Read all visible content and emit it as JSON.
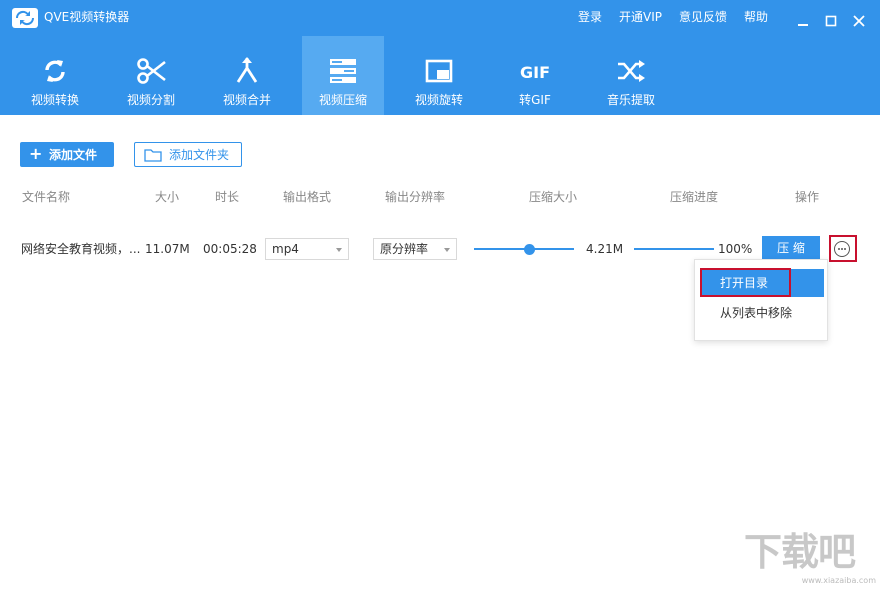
{
  "app": {
    "title": "QVE视频转换器"
  },
  "top_links": [
    "登录",
    "开通VIP",
    "意见反馈",
    "帮助"
  ],
  "toolbar": {
    "tools": [
      {
        "label": "视频转换",
        "icon": "convert-icon"
      },
      {
        "label": "视频分割",
        "icon": "scissors-icon"
      },
      {
        "label": "视频合并",
        "icon": "merge-icon"
      },
      {
        "label": "视频压缩",
        "icon": "compress-icon",
        "active": true
      },
      {
        "label": "视频旋转",
        "icon": "rotate-icon"
      },
      {
        "label": "转GIF",
        "icon": "gif-icon",
        "glyph": "GIF"
      },
      {
        "label": "音乐提取",
        "icon": "shuffle-icon"
      }
    ]
  },
  "actions": {
    "add_file": "添加文件",
    "add_folder": "添加文件夹"
  },
  "table": {
    "headers": [
      "文件名称",
      "大小",
      "时长",
      "输出格式",
      "输出分辨率",
      "压缩大小",
      "压缩进度",
      "操作"
    ],
    "rows": [
      {
        "name": "网络安全教育视频，...",
        "size": "11.07M",
        "duration": "00:05:28",
        "format": "mp4",
        "resolution": "原分辨率",
        "compressed_size": "4.21M",
        "compression_level": 0.6,
        "progress": "100%",
        "progress_value": 1.0,
        "action": "压 缩"
      }
    ]
  },
  "menu": {
    "items": [
      "打开目录",
      "从列表中移除"
    ]
  },
  "watermark": {
    "text": "下载吧",
    "url": "www.xiazaiba.com"
  },
  "colors": {
    "primary": "#3393ea",
    "active_tab": "#56aaf1",
    "highlight_border": "#c8102e"
  }
}
